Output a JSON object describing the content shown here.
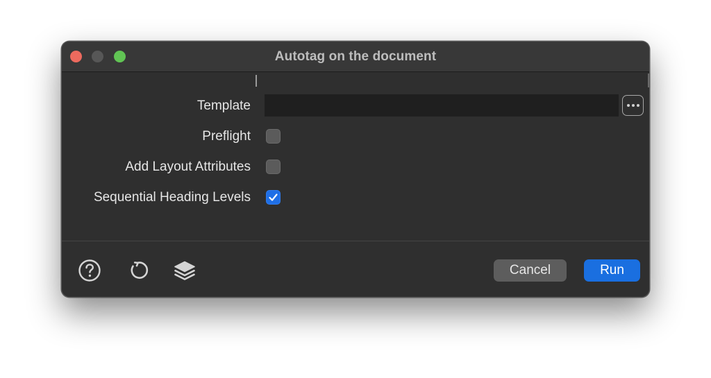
{
  "window": {
    "title": "Autotag on the document"
  },
  "form": {
    "template": {
      "label": "Template",
      "value": "",
      "placeholder": "",
      "browse_icon": "ellipsis-icon"
    },
    "preflight": {
      "label": "Preflight",
      "checked": false
    },
    "add_layout_attributes": {
      "label": "Add Layout Attributes",
      "checked": false
    },
    "sequential_heading_levels": {
      "label": "Sequential Heading Levels",
      "checked": true
    }
  },
  "footer": {
    "icons": [
      "help-icon",
      "reset-icon",
      "layers-icon"
    ],
    "cancel_label": "Cancel",
    "run_label": "Run"
  },
  "colors": {
    "accent": "#1a6fe0",
    "window_bg": "#2f2f2f",
    "close": "#ed6a5e",
    "zoom": "#61c454"
  }
}
